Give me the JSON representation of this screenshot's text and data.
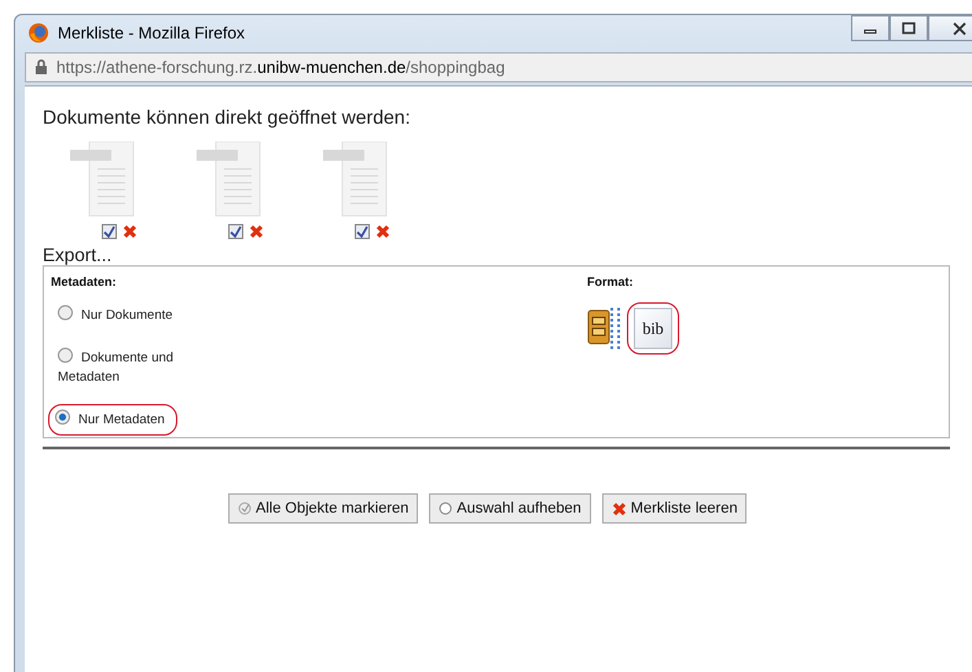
{
  "window": {
    "title": "Merkliste - Mozilla Firefox",
    "url_start": "https://athene-forschung.rz.",
    "url_domain": "unibw-muenchen.de",
    "url_path": "/shoppingbag"
  },
  "heading": "Dokumente können direkt geöffnet werden:",
  "documents": [
    {
      "checked": true
    },
    {
      "checked": true
    },
    {
      "checked": true
    }
  ],
  "export": {
    "title": "Export...",
    "metadata_label": "Metadaten:",
    "options": [
      {
        "label": "Nur Dokumente",
        "selected": false,
        "highlighted": false
      },
      {
        "label": "Dokumente und Metadaten",
        "selected": false,
        "highlighted": false
      },
      {
        "label": "Nur Metadaten",
        "selected": true,
        "highlighted": true
      }
    ],
    "format_label": "Format:",
    "formats": [
      {
        "kind": "zip",
        "highlighted": false
      },
      {
        "kind": "bib",
        "label": "bib",
        "highlighted": true
      }
    ]
  },
  "buttons": [
    {
      "kind": "check",
      "label": "Alle Objekte markieren"
    },
    {
      "kind": "radio",
      "label": "Auswahl aufheben"
    },
    {
      "kind": "delete",
      "label": "Merkliste leeren"
    }
  ]
}
